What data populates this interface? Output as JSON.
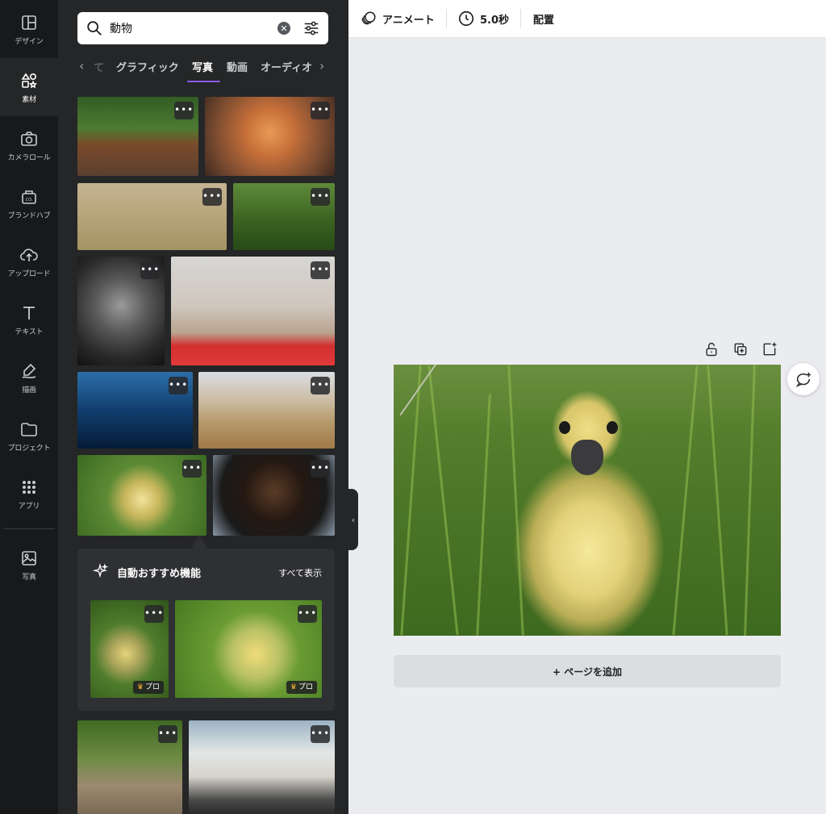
{
  "rail": {
    "items": [
      {
        "label": "デザイン",
        "icon": "layout-icon"
      },
      {
        "label": "素材",
        "icon": "shapes-icon"
      },
      {
        "label": "カメラロール",
        "icon": "camera-icon"
      },
      {
        "label": "ブランドハブ",
        "icon": "brand-icon"
      },
      {
        "label": "アップロード",
        "icon": "cloud-upload-icon"
      },
      {
        "label": "テキスト",
        "icon": "text-icon"
      },
      {
        "label": "描画",
        "icon": "draw-icon"
      },
      {
        "label": "プロジェクト",
        "icon": "folder-icon"
      },
      {
        "label": "アプリ",
        "icon": "apps-grid-icon"
      },
      {
        "label": "写真",
        "icon": "photo-icon"
      }
    ],
    "active_label": "素材"
  },
  "search": {
    "value": "動物"
  },
  "tabs": [
    "て",
    "グラフィック",
    "写真",
    "動画",
    "オーディオ"
  ],
  "active_tab": "写真",
  "photo_more_label": "•••",
  "suggestions": {
    "title": "自動おすすめ機能",
    "see_all": "すべて表示",
    "pro_label": "プロ"
  },
  "topbar": {
    "animate": "アニメート",
    "duration": "5.0秒",
    "position": "配置"
  },
  "canvas": {
    "add_page": "+ ページを追加"
  },
  "colors": {
    "rail_bg": "#18191b",
    "panel_bg": "#252627",
    "accent": "#8b5cf6",
    "canvas_bg": "#ebecf0"
  }
}
